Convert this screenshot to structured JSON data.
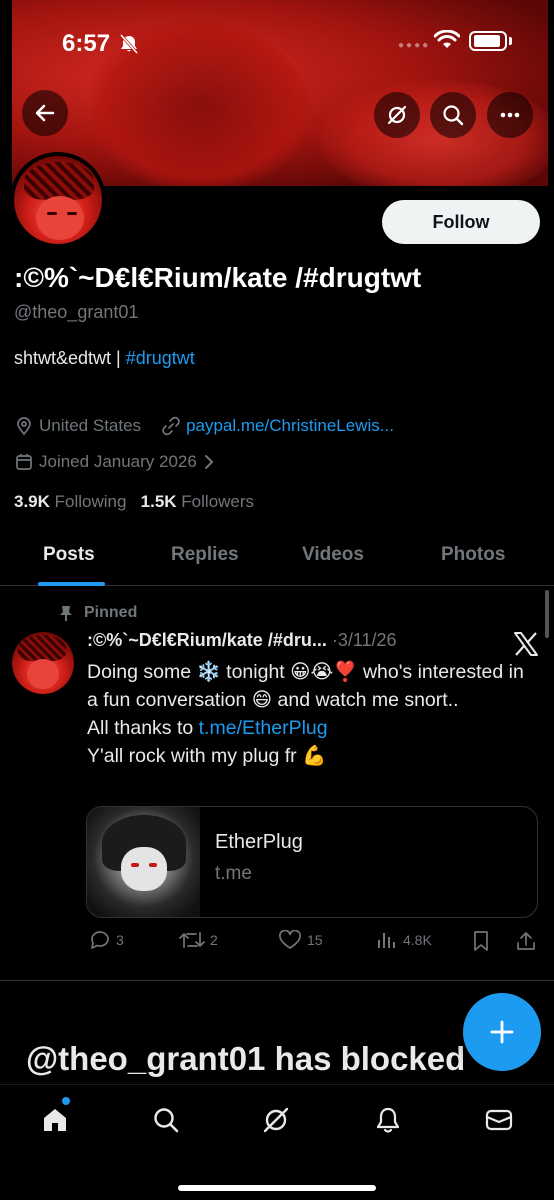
{
  "status_bar": {
    "time": "6:57"
  },
  "profile": {
    "name": ":©%`~D€l€Rium/kate /#drugtwt",
    "handle": "@theo_grant01",
    "bio_prefix": "shtwt&edtwt | ",
    "bio_hashtag": "#drugtwt",
    "location": "United States",
    "link": "paypal.me/ChristineLewis...",
    "joined": "Joined January 2026",
    "following_count": "3.9K",
    "following_label": "Following",
    "followers_count": "1.5K",
    "followers_label": "Followers",
    "follow_button": "Follow"
  },
  "tabs": [
    {
      "label": "Posts",
      "active": true
    },
    {
      "label": "Replies",
      "active": false
    },
    {
      "label": "Videos",
      "active": false
    },
    {
      "label": "Photos",
      "active": false
    }
  ],
  "post": {
    "pinned_label": "Pinned",
    "author": ":©%`~D€l€Rium/kate /#dru...",
    "date": "·3/11/26",
    "text_line1": "Doing some ❄️ tonight 😀😭❣️ who's interested in a fun conversation 😄 and watch me snort..",
    "text_line2_prefix": "All thanks to ",
    "text_link": "t.me/EtherPlug",
    "text_line3": "Y'all rock with my plug fr 💪",
    "card_title": "EtherPlug",
    "card_domain": "t.me",
    "replies": "3",
    "reposts": "2",
    "likes": "15",
    "views": "4.8K"
  },
  "blocked_text": "@theo_grant01 has blocked",
  "colors": {
    "accent": "#1d9bf0",
    "banner": "#c21d18",
    "muted": "#71767b"
  }
}
